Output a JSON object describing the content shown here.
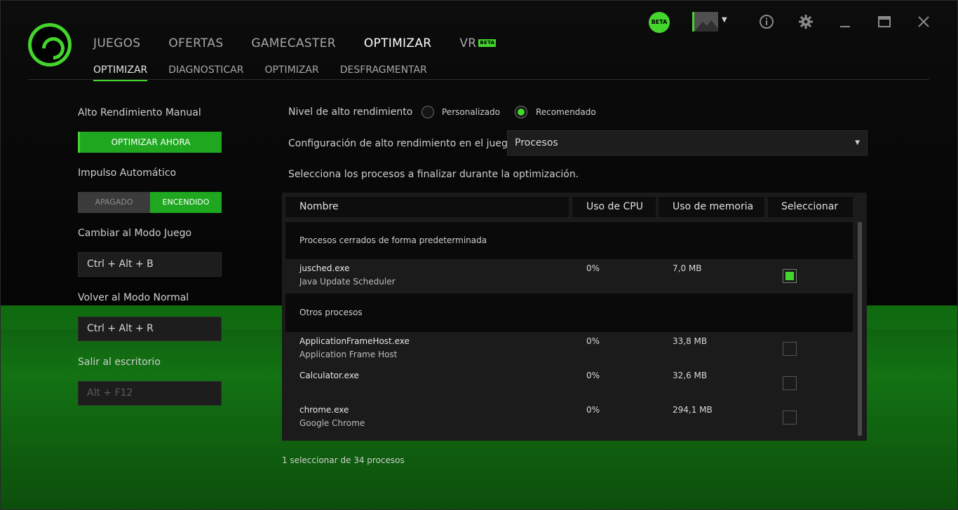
{
  "colors": {
    "accent": "#44d62c",
    "button_green": "#1fa81f",
    "background": "#000000"
  },
  "header": {
    "logo_icon": "razer-cortex-logo-icon",
    "nav": [
      {
        "label": "JUEGOS",
        "active": false
      },
      {
        "label": "OFERTAS",
        "active": false
      },
      {
        "label": "GAMECASTER",
        "active": false
      },
      {
        "label": "OPTIMIZAR",
        "active": true
      },
      {
        "label": "VR",
        "active": false,
        "badge": "BETA"
      }
    ],
    "subnav": [
      {
        "label": "OPTIMIZAR",
        "active": true
      },
      {
        "label": "DIAGNOSTICAR",
        "active": false
      },
      {
        "label": "OPTIMIZAR",
        "active": false
      },
      {
        "label": "DESFRAGMENTAR",
        "active": false
      }
    ],
    "beta_label": "BETA",
    "icons": [
      "user-avatar-icon",
      "info-icon",
      "gear-icon",
      "minimize-icon",
      "maximize-icon",
      "close-icon"
    ]
  },
  "left_panel": {
    "manual_title": "Alto Rendimiento Manual",
    "optimize_button": "OPTIMIZAR AHORA",
    "auto_title": "Impulso Automático",
    "toggle_off": "APAGADO",
    "toggle_on": "ENCENDIDO",
    "toggle_state": "on",
    "game_mode_title": "Cambiar al Modo Juego",
    "game_mode_keys": "Ctrl + Alt + B",
    "normal_mode_title": "Volver al Modo Normal",
    "normal_mode_keys": "Ctrl + Alt + R",
    "desktop_title": "Salir al escritorio",
    "desktop_keys": "Alt + F12"
  },
  "right_panel": {
    "level_label": "Nivel de alto rendimiento",
    "radio_custom": "Personalizado",
    "radio_recommended": "Recomendado",
    "selected_radio": "recommended",
    "ingame_label": "Configuración de alto rendimiento en el juego",
    "ingame_value": "Procesos",
    "instruction": "Selecciona los procesos a finalizar durante la optimización.",
    "table": {
      "headers": [
        "Nombre",
        "Uso de CPU",
        "Uso de memoria",
        "Seleccionar"
      ],
      "group_default": "Procesos cerrados de forma predeterminada",
      "group_other": "Otros procesos",
      "default_rows": [
        {
          "name": "jusched.exe",
          "desc": "Java Update Scheduler",
          "cpu": "0%",
          "mem": "7,0 MB",
          "selected": true
        }
      ],
      "other_rows": [
        {
          "name": "ApplicationFrameHost.exe",
          "desc": "Application Frame Host",
          "cpu": "0%",
          "mem": "33,8 MB",
          "selected": false
        },
        {
          "name": "Calculator.exe",
          "desc": "",
          "cpu": "0%",
          "mem": "32,6 MB",
          "selected": false
        },
        {
          "name": "chrome.exe",
          "desc": "Google Chrome",
          "cpu": "0%",
          "mem": "294,1 MB",
          "selected": false
        }
      ]
    },
    "footer": "1 seleccionar de 34 procesos"
  }
}
